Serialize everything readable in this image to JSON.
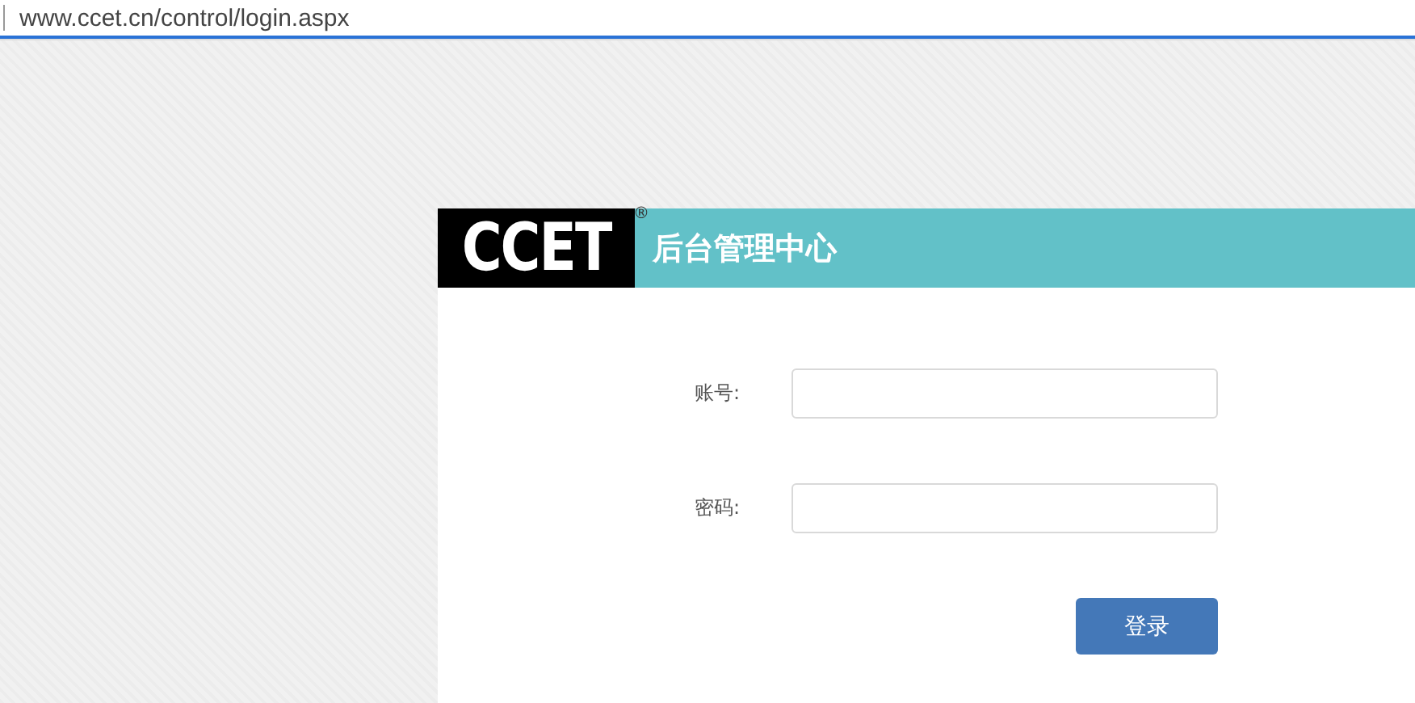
{
  "address_bar": {
    "url": "www.ccet.cn/control/login.aspx"
  },
  "header": {
    "logo": "CCET",
    "logo_mark": "®",
    "title": "后台管理中心"
  },
  "form": {
    "fields": [
      {
        "label": "账号:"
      },
      {
        "label": "密码:"
      }
    ],
    "submit": "登录"
  }
}
